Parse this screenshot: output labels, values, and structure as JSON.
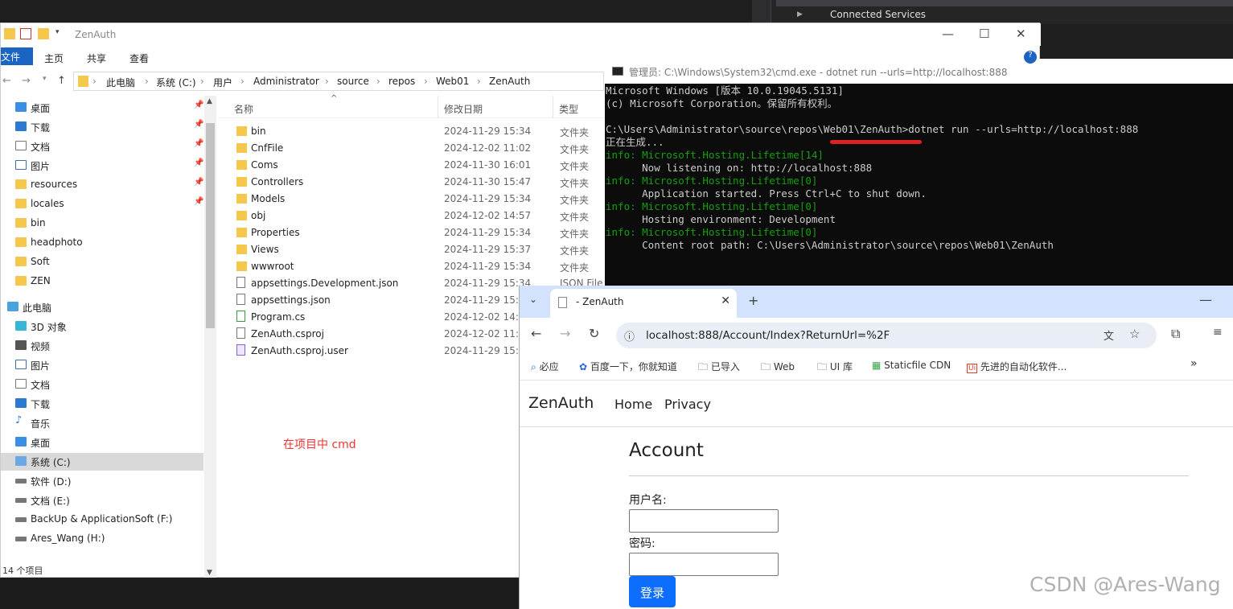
{
  "vs": {
    "connected_services": "Connected Services"
  },
  "explorer": {
    "title": "ZenAuth",
    "ribbon": {
      "file": "文件",
      "home": "主页",
      "share": "共享",
      "view": "查看"
    },
    "breadcrumbs": [
      "此电脑",
      "系统 (C:)",
      "用户",
      "Administrator",
      "source",
      "repos",
      "Web01",
      "ZenAuth"
    ],
    "sidebar": [
      {
        "label": "桌面",
        "pinned": true
      },
      {
        "label": "下载",
        "pinned": true
      },
      {
        "label": "文档",
        "pinned": true
      },
      {
        "label": "图片",
        "pinned": true
      },
      {
        "label": "resources",
        "pinned": true
      },
      {
        "label": "locales",
        "pinned": true
      },
      {
        "label": "bin"
      },
      {
        "label": "headphoto"
      },
      {
        "label": "Soft"
      },
      {
        "label": "ZEN"
      },
      {
        "label": "此电脑"
      },
      {
        "label": "3D 对象"
      },
      {
        "label": "视频"
      },
      {
        "label": "图片"
      },
      {
        "label": "文档"
      },
      {
        "label": "下载"
      },
      {
        "label": "音乐"
      },
      {
        "label": "桌面"
      },
      {
        "label": "系统 (C:)"
      },
      {
        "label": "软件 (D:)"
      },
      {
        "label": "文档 (E:)"
      },
      {
        "label": "BackUp & ApplicationSoft (F:)"
      },
      {
        "label": "Ares_Wang (H:)"
      }
    ],
    "columns": {
      "name": "名称",
      "date": "修改日期",
      "type": "类型"
    },
    "files": [
      {
        "name": "bin",
        "date": "2024-11-29 15:34",
        "type": "文件夹"
      },
      {
        "name": "CnfFile",
        "date": "2024-12-02 11:02",
        "type": "文件夹"
      },
      {
        "name": "Coms",
        "date": "2024-11-30 16:01",
        "type": "文件夹"
      },
      {
        "name": "Controllers",
        "date": "2024-11-30 15:47",
        "type": "文件夹"
      },
      {
        "name": "Models",
        "date": "2024-11-29 15:34",
        "type": "文件夹"
      },
      {
        "name": "obj",
        "date": "2024-12-02 14:57",
        "type": "文件夹"
      },
      {
        "name": "Properties",
        "date": "2024-11-29 15:34",
        "type": "文件夹"
      },
      {
        "name": "Views",
        "date": "2024-11-29 15:37",
        "type": "文件夹"
      },
      {
        "name": "wwwroot",
        "date": "2024-11-29 15:34",
        "type": "文件夹"
      },
      {
        "name": "appsettings.Development.json",
        "date": "2024-11-29 15:34",
        "type": "JSON File"
      },
      {
        "name": "appsettings.json",
        "date": "2024-11-29 15:3",
        "type": ""
      },
      {
        "name": "Program.cs",
        "date": "2024-12-02 14:5",
        "type": ""
      },
      {
        "name": "ZenAuth.csproj",
        "date": "2024-12-02 11:0",
        "type": ""
      },
      {
        "name": "ZenAuth.csproj.user",
        "date": "2024-11-29 15:3",
        "type": ""
      }
    ],
    "annotation": "在项目中  cmd",
    "status": "14 个项目"
  },
  "cmd": {
    "title": "管理员: C:\\Windows\\System32\\cmd.exe - dotnet  run --urls=http://localhost:888",
    "lines": [
      "Microsoft Windows [版本 10.0.19045.5131]",
      "(c) Microsoft Corporation。保留所有权利。",
      "",
      "C:\\Users\\Administrator\\source\\repos\\Web01\\ZenAuth>dotnet run --urls=http://localhost:888",
      "正在生成...",
      "info: Microsoft.Hosting.Lifetime[14]",
      "      Now listening on: http://localhost:888",
      "info: Microsoft.Hosting.Lifetime[0]",
      "      Application started. Press Ctrl+C to shut down.",
      "info: Microsoft.Hosting.Lifetime[0]",
      "      Hosting environment: Development",
      "info: Microsoft.Hosting.Lifetime[0]",
      "      Content root path: C:\\Users\\Administrator\\source\\repos\\Web01\\ZenAuth"
    ]
  },
  "browser": {
    "tab_title": "- ZenAuth",
    "url": "localhost:888/Account/Index?ReturnUrl=%2F",
    "bookmarks": [
      "必应",
      "百度一下，你就知道",
      "已导入",
      "Web",
      "UI 库",
      "Staticfile CDN",
      "先进的自动化软件..."
    ],
    "brand": "ZenAuth",
    "nav": [
      "Home",
      "Privacy"
    ],
    "heading": "Account",
    "username_label": "用户名:",
    "password_label": "密码:",
    "login_button": "登录"
  },
  "watermark": "CSDN @Ares-Wang"
}
